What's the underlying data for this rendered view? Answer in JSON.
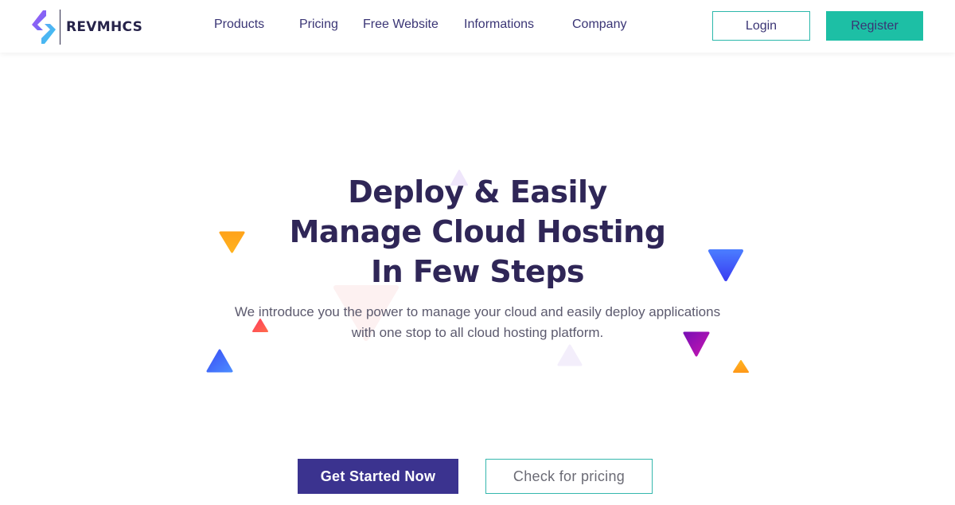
{
  "brand": {
    "name": "REVMHCS",
    "logo_icon": "s-diamond-logo-icon"
  },
  "nav": {
    "items": [
      {
        "label": "Products"
      },
      {
        "label": "Pricing"
      },
      {
        "label": "Free Website"
      },
      {
        "label": "Informations"
      },
      {
        "label": "Company"
      }
    ],
    "login_label": "Login",
    "register_label": "Register"
  },
  "hero": {
    "title_lines": [
      "Deploy & Easily",
      "Manage Cloud Hosting",
      "In Few Steps"
    ],
    "subtitle_lines": [
      "We introduce you the power to manage your cloud and easily deploy applications",
      "with one stop to all cloud hosting platform."
    ],
    "primary_cta": "Get Started Now",
    "secondary_cta": "Check for pricing"
  },
  "colors": {
    "brand_dark": "#2f2657",
    "nav_text": "#3a3575",
    "accent_teal": "#1dbfa5",
    "primary_button": "#3b338f",
    "shape_orange": "#ffa41b",
    "shape_blue": "#3d5afe",
    "shape_red": "#ff4d5e",
    "shape_purple": "#9c0fbd"
  }
}
